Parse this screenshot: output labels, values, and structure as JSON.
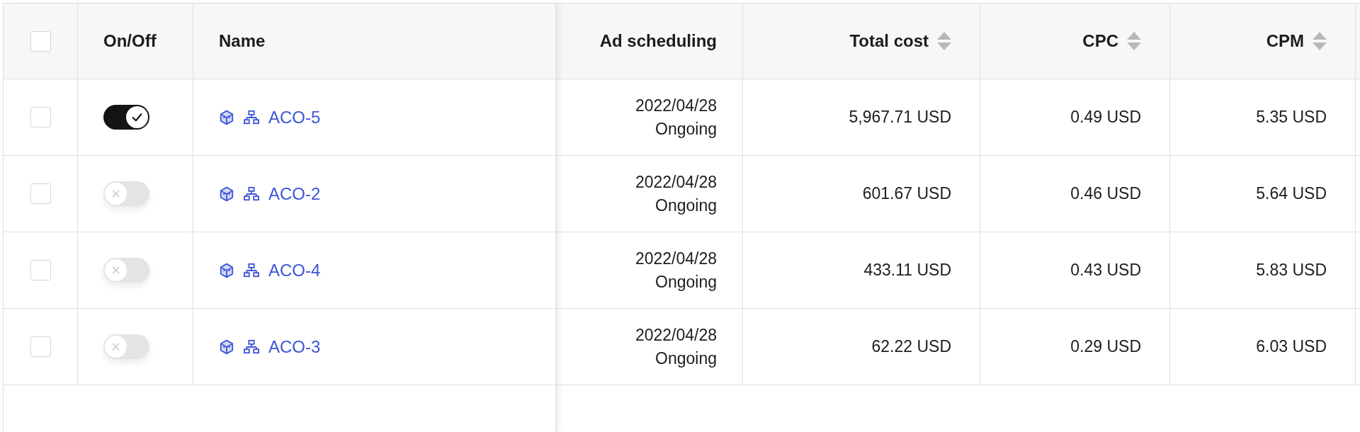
{
  "table": {
    "select_all": {
      "checked": false
    },
    "columns": [
      {
        "label": "On/Off",
        "sortable": false
      },
      {
        "label": "Name",
        "sortable": false
      },
      {
        "label": "Ad scheduling",
        "sortable": false
      },
      {
        "label": "Total cost",
        "sortable": true
      },
      {
        "label": "CPC",
        "sortable": true
      },
      {
        "label": "CPM",
        "sortable": true
      }
    ],
    "rows": [
      {
        "checked": false,
        "on": true,
        "name": "ACO-5",
        "start_date": "2022/04/28",
        "status": "Ongoing",
        "total_cost": "5,967.71 USD",
        "cpc": "0.49 USD",
        "cpm": "5.35 USD"
      },
      {
        "checked": false,
        "on": false,
        "name": "ACO-2",
        "start_date": "2022/04/28",
        "status": "Ongoing",
        "total_cost": "601.67 USD",
        "cpc": "0.46 USD",
        "cpm": "5.64 USD"
      },
      {
        "checked": false,
        "on": false,
        "name": "ACO-4",
        "start_date": "2022/04/28",
        "status": "Ongoing",
        "total_cost": "433.11 USD",
        "cpc": "0.43 USD",
        "cpm": "5.83 USD"
      },
      {
        "checked": false,
        "on": false,
        "name": "ACO-3",
        "start_date": "2022/04/28",
        "status": "Ongoing",
        "total_cost": "62.22 USD",
        "cpc": "0.29 USD",
        "cpm": "6.03 USD"
      }
    ]
  }
}
